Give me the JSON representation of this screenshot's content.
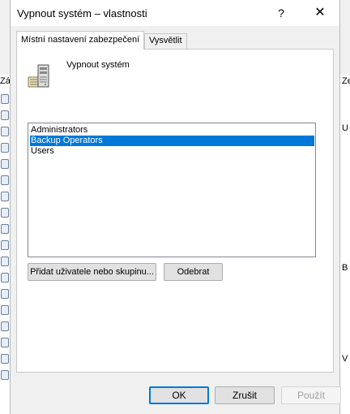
{
  "background": {
    "left_label": "Zás",
    "right_fragments": [
      "Ze",
      "U",
      "B",
      "V"
    ]
  },
  "dialog": {
    "title": "Vypnout systém – vlastnosti",
    "help_glyph": "?",
    "close_glyph": "✕",
    "tabs": [
      {
        "label": "Místní nastavení zabezpečení",
        "active": true
      },
      {
        "label": "Vysvětlit",
        "active": false
      }
    ],
    "policy_name": "Vypnout systém",
    "members": [
      {
        "label": "Administrators",
        "selected": false
      },
      {
        "label": "Backup Operators",
        "selected": true
      },
      {
        "label": "Users",
        "selected": false
      }
    ],
    "add_button": "Přidat uživatele nebo skupinu...",
    "remove_button": "Odebrat",
    "ok_button": "OK",
    "cancel_button": "Zrušit",
    "apply_button": "Použít"
  },
  "colors": {
    "selection": "#0078d7",
    "window_bg": "#f0f0f0",
    "panel_bg": "#ffffff"
  }
}
